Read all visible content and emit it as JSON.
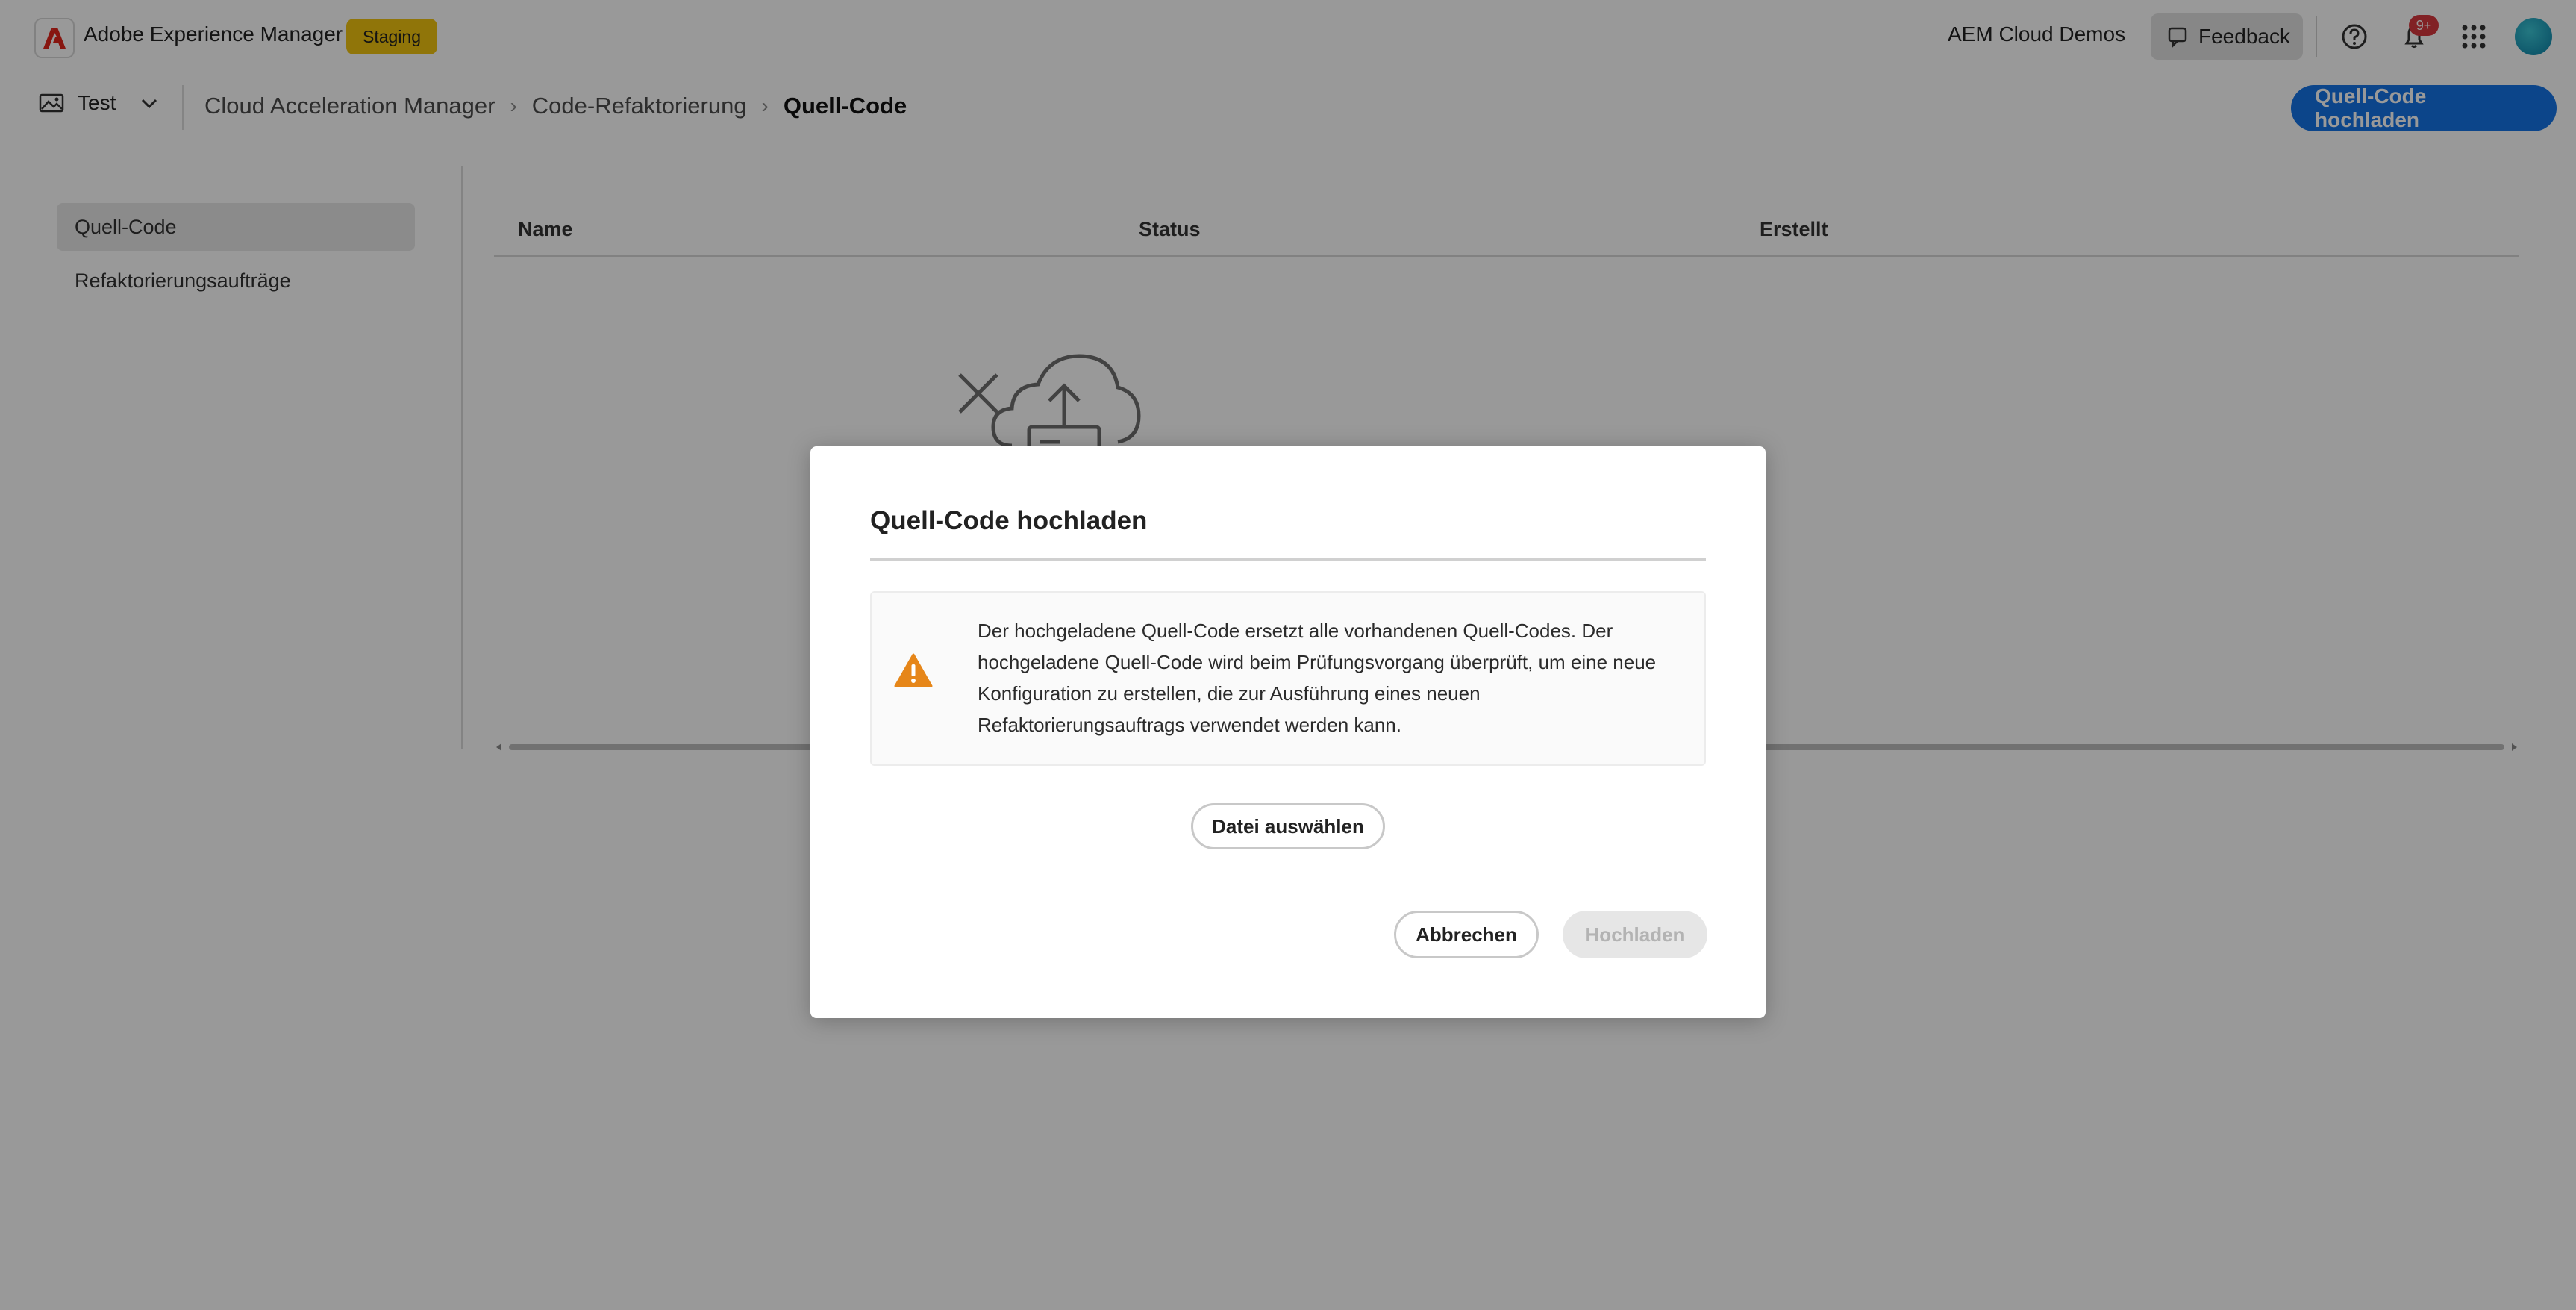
{
  "app": {
    "name": "Adobe Experience Manager",
    "environment_badge": "Staging",
    "org": "AEM Cloud Demos",
    "feedback_label": "Feedback",
    "notification_count": "9+"
  },
  "subheader": {
    "project": "Test",
    "breadcrumb": [
      "Cloud Acceleration Manager",
      "Code-Refaktorierung",
      "Quell-Code"
    ],
    "primary_action": "Quell-Code hochladen"
  },
  "sidebar": {
    "items": [
      {
        "label": "Quell-Code",
        "active": true
      },
      {
        "label": "Refaktorierungsaufträge",
        "active": false
      }
    ]
  },
  "table": {
    "columns": [
      "Name",
      "Status",
      "Erstellt"
    ]
  },
  "dialog": {
    "title": "Quell-Code hochladen",
    "warning": "Der hochgeladene Quell-Code ersetzt alle vorhandenen Quell-Codes. Der hochgeladene Quell-Code wird beim Prüfungsvorgang überprüft, um eine neue Konfiguration zu erstellen, die zur Ausführung eines neuen Refaktorierungsauftrags verwendet werden kann.",
    "choose_file_label": "Datei auswählen",
    "cancel_label": "Abbrechen",
    "upload_label": "Hochladen"
  },
  "colors": {
    "accent": "#1473e6",
    "badge": "#f0c30f",
    "warning": "#e68619",
    "notification": "#d7373f"
  }
}
